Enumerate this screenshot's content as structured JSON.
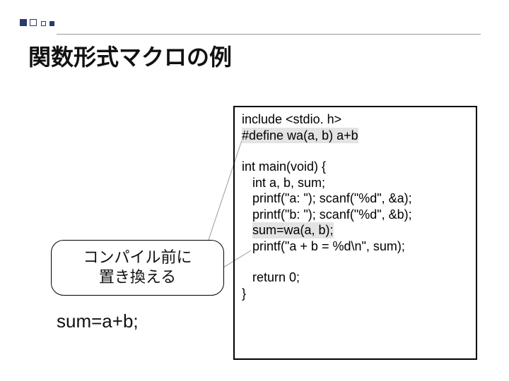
{
  "title": "関数形式マクロの例",
  "callout": {
    "line1": "コンパイル前に",
    "line2": "置き換える"
  },
  "replacement_text": "sum=a+b;",
  "code": {
    "l0": "include <stdio. h>",
    "l1": "#define wa(a, b) a+b",
    "l2": "int main(void) {",
    "l3": "   int a, b, sum;",
    "l4": "   printf(\"a: \"); scanf(\"%d\", &a);",
    "l5": "   printf(\"b: \"); scanf(\"%d\", &b);",
    "l6_indent": "   ",
    "l6_hl": "sum=wa(a, b);",
    "l7": "   printf(\"a + b = %d\\n\", sum);",
    "l8": "   return 0;",
    "l9": "}"
  }
}
